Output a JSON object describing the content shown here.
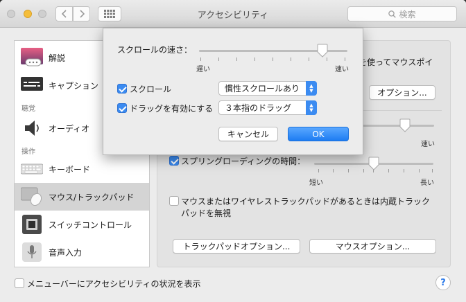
{
  "window": {
    "title": "アクセシビリティ",
    "search_placeholder": "検索"
  },
  "sidebar": {
    "items": [
      {
        "label": "解説"
      },
      {
        "label": "キャプション"
      },
      {
        "label": "オーディオ"
      },
      {
        "label": "キーボード"
      },
      {
        "label": "マウス/トラックパッド"
      },
      {
        "label": "スイッチコントロール"
      },
      {
        "label": "音声入力"
      }
    ],
    "sections": [
      "聴覚",
      "操作"
    ],
    "selected": "マウス/トラックパッド"
  },
  "main": {
    "partial_text": "を使ってマウスポイ",
    "options_button": "オプション...",
    "fast_label": "速い",
    "spring_loading": {
      "label": "スプリングローディングの時間：",
      "checked": true,
      "min_label": "短い",
      "max_label": "長い",
      "value": 0.5
    },
    "ignore_builtin": {
      "label_line1": "マウスまたはワイヤレストラックパッドがあるときは内蔵トラック",
      "label_line2": "パッドを無視",
      "checked": false
    },
    "trackpad_options_button": "トラックパッドオプション...",
    "mouse_options_button": "マウスオプション...",
    "partial_slider_value": 0.6
  },
  "footer": {
    "show_status_label": "メニューバーにアクセシビリティの状況を表示",
    "show_status_checked": false,
    "help": "?"
  },
  "popup": {
    "scroll_speed_label": "スクロールの速さ：",
    "slow_label": "遅い",
    "fast_label": "速い",
    "scroll_speed_value": 0.83,
    "scroll": {
      "label": "スクロール",
      "checked": true,
      "selected_option": "慣性スクロールあり"
    },
    "drag": {
      "label": "ドラッグを有効にする",
      "checked": true,
      "selected_option": "３本指のドラッグ"
    },
    "cancel_button": "キャンセル",
    "ok_button": "OK"
  },
  "colors": {
    "accent": "#3b8bf1",
    "window_bg": "#ececec"
  }
}
